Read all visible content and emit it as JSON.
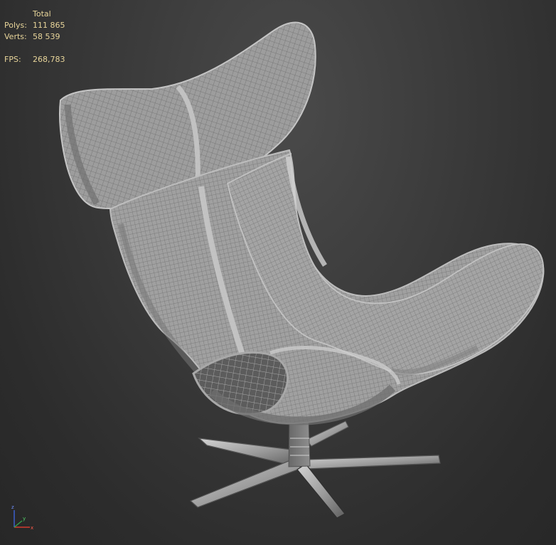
{
  "viewport_stats": {
    "header": "Total",
    "polys_label": "Polys:",
    "polys_value": "111 865",
    "verts_label": "Verts:",
    "verts_value": "58 539",
    "fps_label": "FPS:",
    "fps_value": "268,783"
  },
  "axis_gizmo": {
    "x_label": "x",
    "y_label": "y",
    "z_label": "z",
    "x_color": "#d23b2f",
    "y_color": "#33a24a",
    "z_color": "#3d63d8"
  },
  "colors": {
    "stats_text": "#e8d59a",
    "wire_main": "#9b9b9b",
    "wire_light": "#c8c8c8",
    "wire_dark": "#4b4b4b"
  }
}
